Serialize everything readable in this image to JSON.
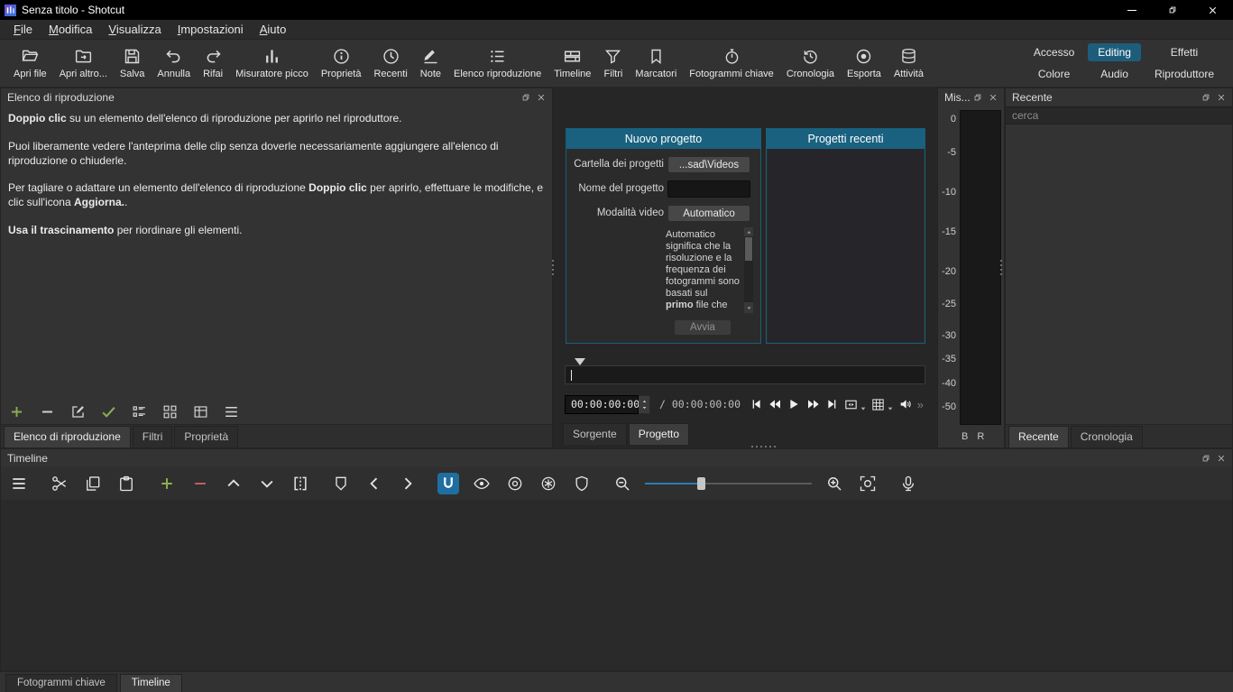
{
  "titlebar": {
    "title": "Senza titolo - Shotcut"
  },
  "menubar": {
    "items": [
      "File",
      "Modifica",
      "Visualizza",
      "Impostazioni",
      "Aiuto"
    ]
  },
  "toolbar": {
    "buttons": [
      {
        "label": "Apri file",
        "icon": "open-file-icon"
      },
      {
        "label": "Apri altro...",
        "icon": "open-other-icon"
      },
      {
        "label": "Salva",
        "icon": "save-icon"
      },
      {
        "label": "Annulla",
        "icon": "undo-icon"
      },
      {
        "label": "Rifai",
        "icon": "redo-icon"
      },
      {
        "label": "Misuratore picco",
        "icon": "peak-meter-icon"
      },
      {
        "label": "Proprietà",
        "icon": "properties-icon"
      },
      {
        "label": "Recenti",
        "icon": "recents-icon"
      },
      {
        "label": "Note",
        "icon": "notes-icon"
      },
      {
        "label": "Elenco riproduzione",
        "icon": "playlist-icon"
      },
      {
        "label": "Timeline",
        "icon": "timeline-icon"
      },
      {
        "label": "Filtri",
        "icon": "filters-icon"
      },
      {
        "label": "Marcatori",
        "icon": "markers-icon"
      },
      {
        "label": "Fotogrammi chiave",
        "icon": "keyframes-icon"
      },
      {
        "label": "Cronologia",
        "icon": "history-icon"
      },
      {
        "label": "Esporta",
        "icon": "export-icon"
      },
      {
        "label": "Attività",
        "icon": "jobs-icon"
      }
    ],
    "workspace_tabs": {
      "row1": [
        "Accesso",
        "Editing",
        "Effetti"
      ],
      "row2": [
        "Colore",
        "Audio",
        "Riproduttore"
      ],
      "active": "Editing"
    }
  },
  "playlist": {
    "title": "Elenco di riproduzione",
    "p1_bold": "Doppio clic",
    "p1_rest": " su un elemento dell'elenco di riproduzione per aprirlo nel riproduttore.",
    "p2": "Puoi liberamente vedere l'anteprima delle clip senza doverle necessariamente aggiungere all'elenco di riproduzione o chiuderle.",
    "p3_a": "Per tagliare o adattare un elemento dell'elenco di riproduzione ",
    "p3_bold1": "Doppio clic",
    "p3_b": " per aprirlo, effettuare le modifiche, e clic sull'icona ",
    "p3_bold2": "Aggiorna.",
    "p3_c": ".",
    "p4_bold": "Usa il trascinamento",
    "p4_rest": " per riordinare gli elementi.",
    "tabs": [
      "Elenco di riproduzione",
      "Filtri",
      "Proprietà"
    ],
    "active_tab": "Elenco di riproduzione"
  },
  "new_project": {
    "title": "Nuovo progetto",
    "folder_label": "Cartella dei progetti",
    "folder_value": "...sad\\Videos",
    "name_label": "Nome del progetto",
    "name_value": "",
    "video_mode_label": "Modalità video",
    "video_mode_value": "Automatico",
    "mode_desc_lines": [
      "Automatico",
      "significa che la",
      "risoluzione e la",
      "frequenza dei",
      "fotogrammi sono",
      "basati sul"
    ],
    "mode_desc_bold": "primo",
    "mode_desc_tail": " file che",
    "start_button": "Avvia"
  },
  "recent_projects": {
    "title": "Progetti recenti"
  },
  "player": {
    "position": "00:00:00:00",
    "separator": "/",
    "duration": "00:00:00:00",
    "overflow": "»",
    "tabs": [
      "Sorgente",
      "Progetto"
    ],
    "active_tab": "Progetto"
  },
  "peak_meter": {
    "title": "Mis...",
    "scale": [
      "0",
      "-5",
      "-10",
      "-15",
      "-20",
      "-25",
      "-30",
      "-35",
      "-40",
      "-50"
    ],
    "channels": [
      "B",
      "R"
    ]
  },
  "recent_panel": {
    "title": "Recente",
    "search_placeholder": "cerca",
    "tabs": [
      "Recente",
      "Cronologia"
    ],
    "active_tab": "Recente"
  },
  "timeline": {
    "title": "Timeline"
  },
  "bottom_tabs": {
    "tabs": [
      "Fotogrammi chiave",
      "Timeline"
    ],
    "active": "Timeline"
  }
}
